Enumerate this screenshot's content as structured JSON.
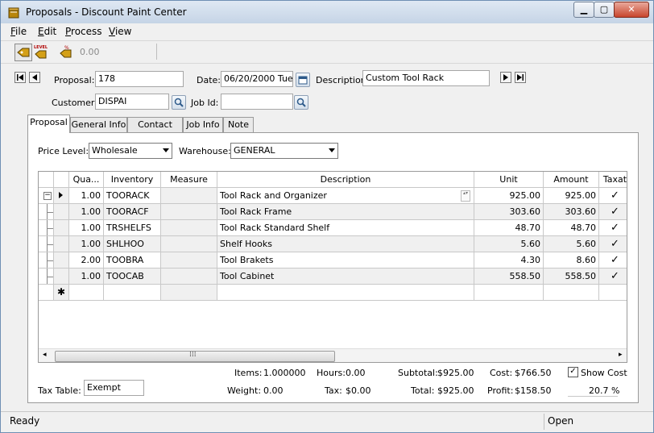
{
  "window": {
    "title": "Proposals - Discount Paint Center"
  },
  "menu": {
    "file": {
      "u": "F",
      "rest": "ile"
    },
    "edit": {
      "u": "E",
      "rest": "dit"
    },
    "process": {
      "u": "P",
      "rest": "rocess"
    },
    "view": {
      "u": "V",
      "rest": "iew"
    }
  },
  "toolbar": {
    "total": "0.00",
    "level_icon_text": "LEVEL"
  },
  "header": {
    "proposal_label": "Proposal:",
    "proposal": "178",
    "date_label": "Date:",
    "date": "06/20/2000 Tue",
    "description_label": "Description:",
    "description": "Custom Tool Rack",
    "customer_label": "Customer:",
    "customer": "DISPAI",
    "jobid_label": "Job Id:",
    "jobid": ""
  },
  "tabs": [
    {
      "label": "Proposal"
    },
    {
      "label": "General Info"
    },
    {
      "label": "Contact Info"
    },
    {
      "label": "Job Info"
    },
    {
      "label": "Note"
    }
  ],
  "price_level": {
    "label": "Price Level:",
    "value": "Wholesale"
  },
  "warehouse": {
    "label": "Warehouse:",
    "value": "GENERAL"
  },
  "grid": {
    "columns": [
      "Qua...",
      "Inventory",
      "Measure",
      "Description",
      "Unit",
      "Amount",
      "Taxat"
    ],
    "rows": [
      {
        "qty": "1.00",
        "inv": "TOORACK",
        "measure": "",
        "desc": "Tool Rack and Organizer",
        "unit": "925.00",
        "amount": "925.00",
        "tax": "✓"
      },
      {
        "qty": "1.00",
        "inv": "TOORACF",
        "measure": "",
        "desc": "Tool Rack Frame",
        "unit": "303.60",
        "amount": "303.60",
        "tax": "✓"
      },
      {
        "qty": "1.00",
        "inv": "TRSHELFS",
        "measure": "",
        "desc": "Tool Rack Standard Shelf",
        "unit": "48.70",
        "amount": "48.70",
        "tax": "✓"
      },
      {
        "qty": "1.00",
        "inv": "SHLHOO",
        "measure": "",
        "desc": "Shelf Hooks",
        "unit": "5.60",
        "amount": "5.60",
        "tax": "✓"
      },
      {
        "qty": "2.00",
        "inv": "TOOBRA",
        "measure": "",
        "desc": "Tool Brakets",
        "unit": "4.30",
        "amount": "8.60",
        "tax": "✓"
      },
      {
        "qty": "1.00",
        "inv": "TOOCAB",
        "measure": "",
        "desc": "Tool Cabinet",
        "unit": "558.50",
        "amount": "558.50",
        "tax": "✓"
      }
    ],
    "new_row_marker": "✱"
  },
  "summary": {
    "items_label": "Items:",
    "items": "1.000000",
    "hours_label": "Hours:",
    "hours": "0.00",
    "subtotal_label": "Subtotal:",
    "subtotal": "$925.00",
    "cost_label": "Cost:",
    "cost": "$766.50",
    "show_cost_label": "Show Cost",
    "weight_label": "Weight:",
    "weight": "0.00",
    "tax_label": "Tax:",
    "tax": "$0.00",
    "total_label": "Total:",
    "total": "$925.00",
    "profit_label": "Profit:",
    "profit": "$158.50",
    "profit_pct": "20.7 %",
    "tax_table_label": "Tax Table:",
    "tax_table": "Exempt"
  },
  "status": {
    "left": "Ready",
    "right": "Open"
  }
}
